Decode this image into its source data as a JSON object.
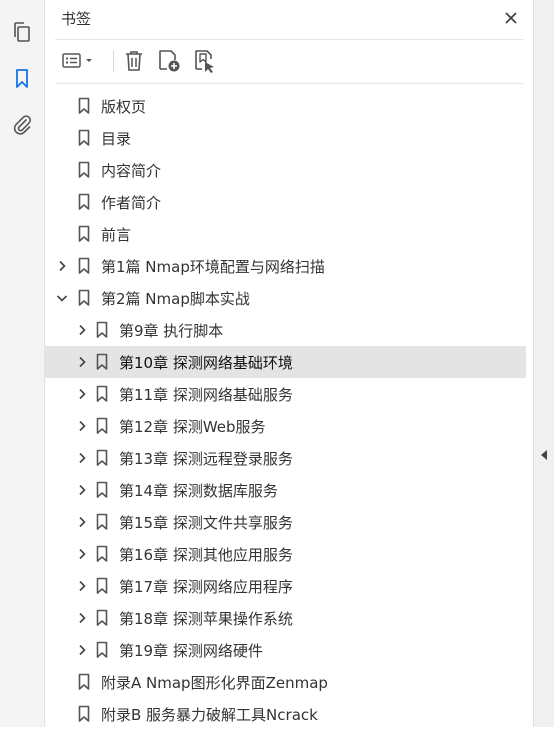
{
  "rail": {
    "items": [
      {
        "icon": "pages-icon",
        "active": false
      },
      {
        "icon": "bookmark-icon",
        "active": true
      },
      {
        "icon": "attachment-icon",
        "active": false
      }
    ]
  },
  "panel": {
    "title": "书签",
    "toolbar": {
      "options": "options-menu-icon",
      "delete": "delete-icon",
      "new": "new-bookmark-icon",
      "find": "find-bookmark-icon"
    }
  },
  "bookmarks": [
    {
      "label": "版权页",
      "level": 0,
      "toggle": "none",
      "selected": false
    },
    {
      "label": "目录",
      "level": 0,
      "toggle": "none",
      "selected": false
    },
    {
      "label": "内容简介",
      "level": 0,
      "toggle": "none",
      "selected": false
    },
    {
      "label": "作者简介",
      "level": 0,
      "toggle": "none",
      "selected": false
    },
    {
      "label": "前言",
      "level": 0,
      "toggle": "none",
      "selected": false
    },
    {
      "label": "第1篇 Nmap环境配置与网络扫描",
      "level": 0,
      "toggle": "collapsed",
      "selected": false
    },
    {
      "label": "第2篇 Nmap脚本实战",
      "level": 0,
      "toggle": "expanded",
      "selected": false
    },
    {
      "label": "第9章 执行脚本",
      "level": 1,
      "toggle": "collapsed",
      "selected": false
    },
    {
      "label": "第10章 探测网络基础环境",
      "level": 1,
      "toggle": "collapsed",
      "selected": true
    },
    {
      "label": "第11章 探测网络基础服务",
      "level": 1,
      "toggle": "collapsed",
      "selected": false
    },
    {
      "label": "第12章 探测Web服务",
      "level": 1,
      "toggle": "collapsed",
      "selected": false
    },
    {
      "label": "第13章 探测远程登录服务",
      "level": 1,
      "toggle": "collapsed",
      "selected": false
    },
    {
      "label": "第14章 探测数据库服务",
      "level": 1,
      "toggle": "collapsed",
      "selected": false
    },
    {
      "label": "第15章 探测文件共享服务",
      "level": 1,
      "toggle": "collapsed",
      "selected": false
    },
    {
      "label": "第16章 探测其他应用服务",
      "level": 1,
      "toggle": "collapsed",
      "selected": false
    },
    {
      "label": "第17章 探测网络应用程序",
      "level": 1,
      "toggle": "collapsed",
      "selected": false
    },
    {
      "label": "第18章 探测苹果操作系统",
      "level": 1,
      "toggle": "collapsed",
      "selected": false
    },
    {
      "label": "第19章 探测网络硬件",
      "level": 1,
      "toggle": "collapsed",
      "selected": false
    },
    {
      "label": "附录A Nmap图形化界面Zenmap",
      "level": 0,
      "toggle": "none",
      "selected": false
    },
    {
      "label": "附录B 服务暴力破解工具Ncrack",
      "level": 0,
      "toggle": "none",
      "selected": false
    }
  ],
  "colors": {
    "accent": "#1473e6",
    "icon": "#555555",
    "selected_bg": "#e4e4e4"
  }
}
